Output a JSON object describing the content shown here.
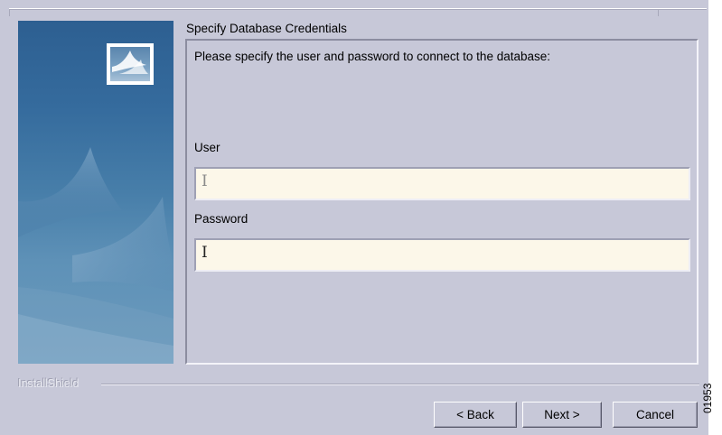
{
  "dialog": {
    "step_title": "Specify Database Credentials",
    "instructions": "Please specify the user and password to connect to the database:",
    "banner_logo_icon": "installshield-tent-logo-icon",
    "brand": "InstallShield",
    "colors": {
      "dialog_background": "#c7c8d8",
      "input_background": "#fcf7e9",
      "banner_blue": "#356b9d"
    }
  },
  "fields": {
    "user": {
      "label": "User",
      "value": ""
    },
    "password": {
      "label": "Password",
      "value": ""
    }
  },
  "buttons": {
    "back": "< Back",
    "next": "Next >",
    "cancel": "Cancel"
  },
  "figure_number": "01953"
}
